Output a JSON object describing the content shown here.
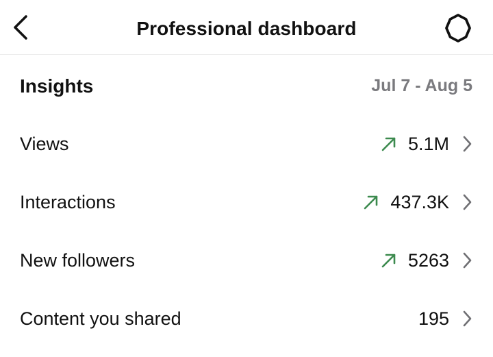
{
  "header": {
    "title": "Professional dashboard",
    "back_icon": "chevron-left-icon",
    "settings_icon": "gear-icon"
  },
  "insights": {
    "title": "Insights",
    "date_range": "Jul 7 - Aug 5"
  },
  "rows": [
    {
      "label": "Views",
      "value": "5.1M",
      "trend": "up"
    },
    {
      "label": "Interactions",
      "value": "437.3K",
      "trend": "up"
    },
    {
      "label": "New followers",
      "value": "5263",
      "trend": "up"
    },
    {
      "label": "Content you shared",
      "value": "195",
      "trend": "none"
    }
  ],
  "colors": {
    "trend_up": "#3c8a4e",
    "muted_text": "#7a7a7e",
    "chevron": "#6f6f73"
  }
}
